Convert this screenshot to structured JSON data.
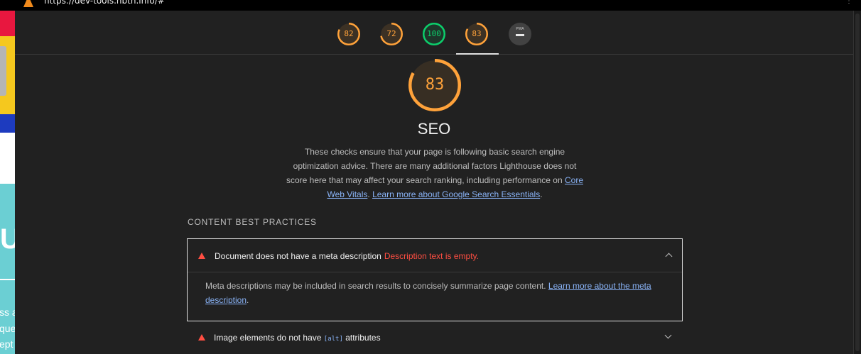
{
  "browser": {
    "url": "https://dev-tools.hbtn.info/#"
  },
  "background_page": {
    "text_fragments": [
      "ss a",
      "que",
      "ept"
    ]
  },
  "gauges": [
    {
      "name": "performance",
      "score": 82,
      "color": "#ffa23a"
    },
    {
      "name": "accessibility",
      "score": 72,
      "color": "#ffa23a"
    },
    {
      "name": "best-practices",
      "score": 100,
      "color": "#0cce6b"
    },
    {
      "name": "seo",
      "score": 83,
      "color": "#ffa23a",
      "selected": true
    }
  ],
  "pwa_badge": {
    "label": "PWA"
  },
  "category": {
    "score": 83,
    "title": "SEO",
    "description": "These checks ensure that your page is following basic search engine optimization advice. There are many additional factors Lighthouse does not score here that may affect your search ranking, including performance on",
    "link1": "Core Web Vitals",
    "separator": ".",
    "link2": "Learn more about Google Search Essentials",
    "end": "."
  },
  "section_title": "CONTENT BEST PRACTICES",
  "audits": [
    {
      "title": "Document does not have a meta description",
      "error": "Description text is empty.",
      "expanded": true,
      "body": "Meta descriptions may be included in search results to concisely summarize page content.",
      "link": "Learn more about the meta description",
      "body_end": "."
    },
    {
      "title_pre": "Image elements do not have",
      "code": "[alt]",
      "title_post": "attributes",
      "expanded": false
    }
  ]
}
